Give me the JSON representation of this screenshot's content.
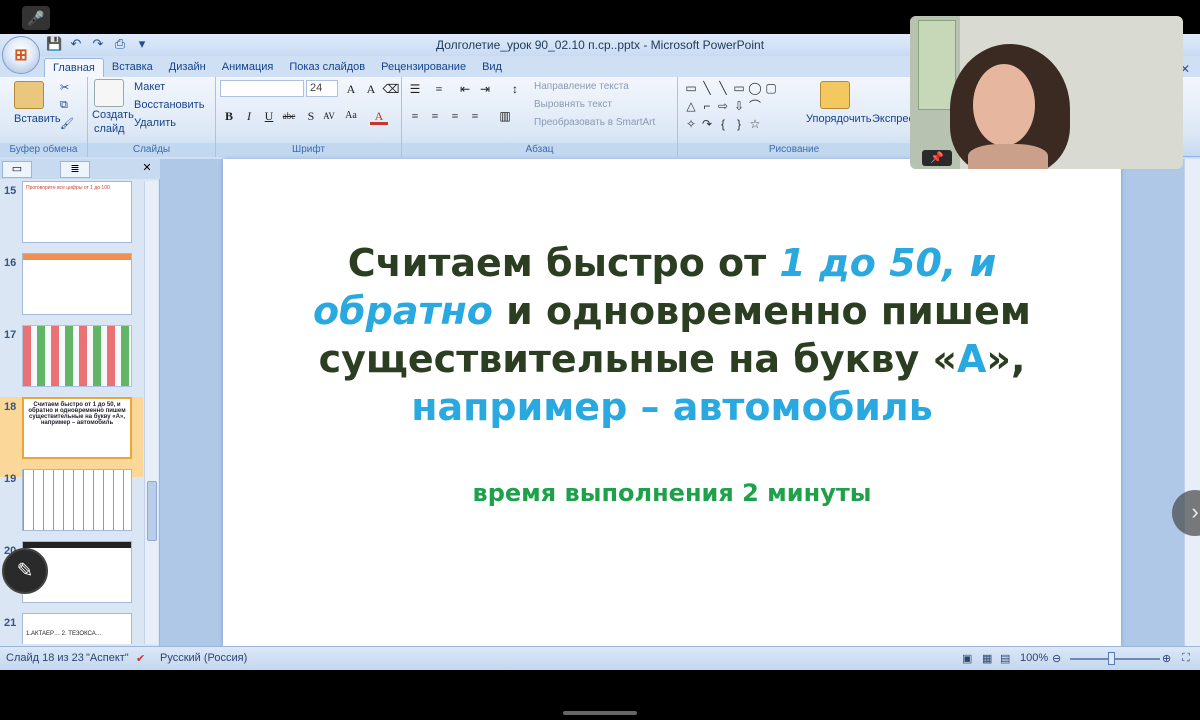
{
  "app": {
    "window_title": "Долголетие_урок 90_02.10 п.ср..pptx - Microsoft PowerPoint",
    "office_logo": "office-logo",
    "tabs": [
      "Главная",
      "Вставка",
      "Дизайн",
      "Анимация",
      "Показ слайдов",
      "Рецензирование",
      "Вид"
    ]
  },
  "ribbon": {
    "clipboard": {
      "paste": "Вставить",
      "label": "Буфер обмена"
    },
    "slides": {
      "new_slide_1": "Создать",
      "new_slide_2": "слайд",
      "layout": "Макет",
      "reset": "Восстановить",
      "delete": "Удалить",
      "label": "Слайды"
    },
    "font": {
      "size": "24",
      "label": "Шрифт"
    },
    "paragraph": {
      "text_direction": "Направление текста",
      "align_text": "Выровнять текст",
      "smartart": "Преобразовать в SmartArt",
      "label": "Абзац"
    },
    "drawing": {
      "arrange": "Упорядочить",
      "quick_styles": "Экспресс",
      "label": "Рисование"
    }
  },
  "thumbnails": [
    {
      "num": "15",
      "text": "Проговорите все цифры от 1 до 100"
    },
    {
      "num": "16",
      "text": ""
    },
    {
      "num": "17",
      "text": ""
    },
    {
      "num": "18",
      "text": "Считаем быстро от 1 до 50, и обратно и одновременно пишем существительные на букву «А», например – автомобиль",
      "selected": true
    },
    {
      "num": "19",
      "text": ""
    },
    {
      "num": "20",
      "text": ""
    },
    {
      "num": "21",
      "text": "1.АКТАЕР… 2. ТЕЗОКСА…"
    }
  ],
  "slide": {
    "line1_a": "Считаем быстро от ",
    "line1_b": "1 до 50, и",
    "line2_a": "обратно",
    "line2_b": " и одновременно пишем",
    "line3_a": "существительные на букву «",
    "line3_b": "А",
    "line3_c": "»,",
    "line4": "например – автомобиль",
    "time": "время выполнения 2 минуты"
  },
  "status": {
    "slide_info": "Слайд 18 из 23",
    "theme": "\"Аспект\"",
    "language": "Русский (Россия)",
    "zoom": "100%"
  },
  "icons": {
    "mute": "microphone-muted-icon",
    "pen": "pen-icon",
    "next": "chevron-right-icon",
    "pin": "pin-icon"
  }
}
